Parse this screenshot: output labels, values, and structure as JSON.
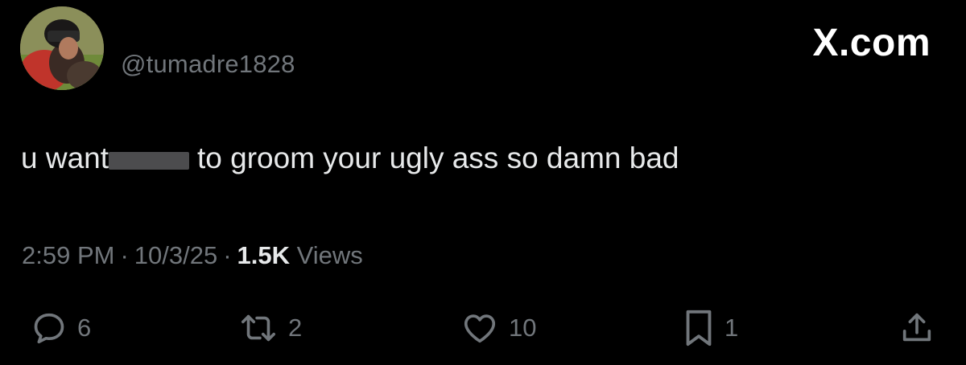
{
  "tweet": {
    "handle": "@tumadre1828",
    "text_before": "u want",
    "text_after": "to groom your ugly ass so damn bad",
    "time": "2:59 PM",
    "date": "10/3/25",
    "separator": "·",
    "views_count": "1.5K",
    "views_label": "Views"
  },
  "watermark": "X.com",
  "actions": {
    "reply_count": "6",
    "repost_count": "2",
    "like_count": "10",
    "bookmark_count": "1"
  },
  "icons": {
    "reply": "reply-icon",
    "repost": "repost-icon",
    "like": "heart-icon",
    "bookmark": "bookmark-icon",
    "share": "share-icon"
  },
  "colors": {
    "background": "#000000",
    "primary_text": "#e7e9ea",
    "secondary_text": "#71767b",
    "watermark": "#ffffff"
  }
}
